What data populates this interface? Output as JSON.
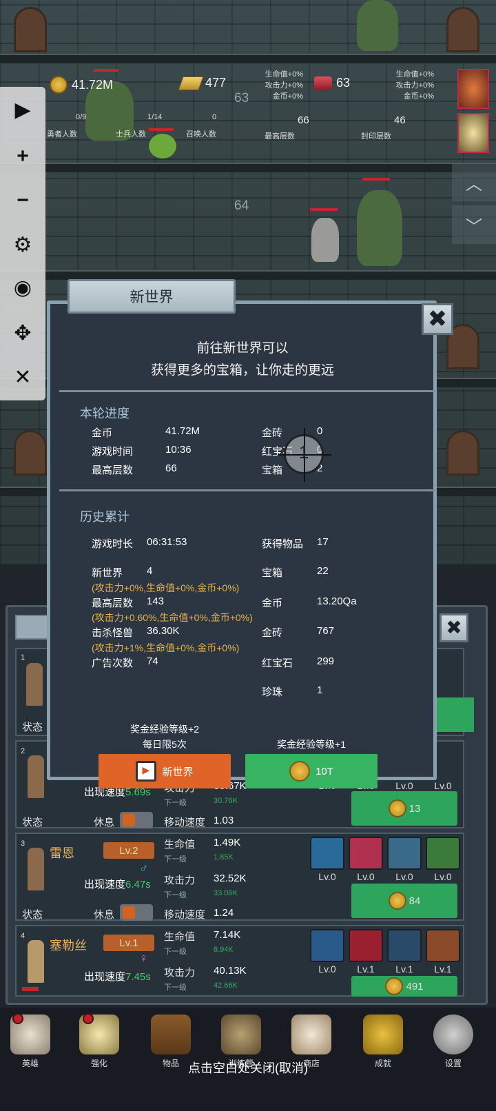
{
  "top": {
    "gold": "41.72M",
    "gold_bars": "477",
    "ruby": "63",
    "center_bonus": [
      "生命值+0%",
      "攻击力+0%",
      "金币+0%"
    ],
    "right_bonus": [
      "生命值+0%",
      "攻击力+0%",
      "金币+0%"
    ],
    "hero_count": "0/9",
    "hero_label": "勇者人数",
    "soldier_count": "1/14",
    "soldier_label": "士兵人数",
    "summon_count": "0",
    "summon_label": "召唤人数",
    "max_floor": "66",
    "max_floor_label": "最高层数",
    "seal_floor": "46",
    "seal_floor_label": "封印层数"
  },
  "floors": {
    "a": "63",
    "b": "64"
  },
  "modal": {
    "tab_title": "新世界",
    "intro_line1": "前往新世界可以",
    "intro_line2": "获得更多的宝箱，让你走的更远",
    "round_title": "本轮进度",
    "round": {
      "gold_label": "金币",
      "gold": "41.72M",
      "bars_label": "金砖",
      "bars": "0",
      "time_label": "游戏时间",
      "time": "10:36",
      "ruby_label": "红宝石",
      "ruby": "0",
      "floor_label": "最高层数",
      "floor": "66",
      "chest_label": "宝箱",
      "chest": "2"
    },
    "history_title": "历史累计",
    "history": {
      "playtime_label": "游戏时长",
      "playtime": "06:31:53",
      "items_label": "获得物品",
      "items": "17",
      "newworld_label": "新世界",
      "newworld": "4",
      "newworld_bonus": "(攻击力+0%,生命值+0%,金币+0%)",
      "chest_label": "宝箱",
      "chest": "22",
      "maxfloor_label": "最高层数",
      "maxfloor": "143",
      "maxfloor_bonus": "(攻击力+0.60%,生命值+0%,金币+0%)",
      "gold_label": "金币",
      "gold": "13.20Qa",
      "kills_label": "击杀怪兽",
      "kills": "36.30K",
      "kills_bonus": "(攻击力+1%,生命值+0%,金币+0%)",
      "bars_label": "金砖",
      "bars": "767",
      "ads_label": "广告次数",
      "ads": "74",
      "ruby_label": "红宝石",
      "ruby": "299",
      "pearl_label": "珍珠",
      "pearl": "1"
    },
    "left_reward_line1": "奖金经验等级+2",
    "left_reward_line2": "每日限5次",
    "right_reward": "奖金经验等级+1",
    "btn_ad_label": "新世界",
    "btn_gold_label": "10T",
    "cursor_number": "1"
  },
  "heroes": [
    {
      "num": "1",
      "status_label": "状态"
    },
    {
      "num": "2",
      "speed_label": "出现速度",
      "speed": "5.69s",
      "status_label": "状态",
      "rest_label": "休息",
      "atk_label": "攻击力",
      "atk": "30.67K",
      "next_label": "下一级",
      "atk_next": "30.76K",
      "move_label": "移动速度",
      "move": "1.03",
      "skill_lvs": [
        "Lv.0",
        "Lv.0",
        "Lv.0",
        "Lv.0"
      ],
      "cost": "13"
    },
    {
      "num": "3",
      "name": "雷恩",
      "lv": "Lv.2",
      "speed_label": "出现速度",
      "speed": "6.47s",
      "status_label": "状态",
      "rest_label": "休息",
      "hp_label": "生命值",
      "hp": "1.49K",
      "next_label": "下一级",
      "hp_next": "1.85K",
      "atk_label": "攻击力",
      "atk": "32.52K",
      "atk_next": "33.06K",
      "move_label": "移动速度",
      "move": "1.24",
      "skill_lvs": [
        "Lv.0",
        "Lv.0",
        "Lv.0",
        "Lv.0"
      ],
      "cost": "84"
    },
    {
      "num": "4",
      "name": "塞勒丝",
      "lv": "Lv.1",
      "speed_label": "出现速度",
      "speed": "7.45s",
      "hp_label": "生命值",
      "hp": "7.14K",
      "next_label": "下一级",
      "hp_next": "8.94K",
      "atk_label": "攻击力",
      "atk": "40.13K",
      "atk_next": "42.66K",
      "skill_lvs": [
        "Lv.0",
        "Lv.1",
        "Lv.1",
        "Lv.1"
      ],
      "cost": "491"
    }
  ],
  "nav": [
    "英雄",
    "强化",
    "物品",
    "训练营",
    "商店",
    "成就",
    "设置"
  ],
  "hint": "点击空白处关闭(取消)",
  "colors": {
    "accent_orange": "#e06428",
    "accent_green": "#37b462",
    "bonus_text": "#e8b545"
  }
}
